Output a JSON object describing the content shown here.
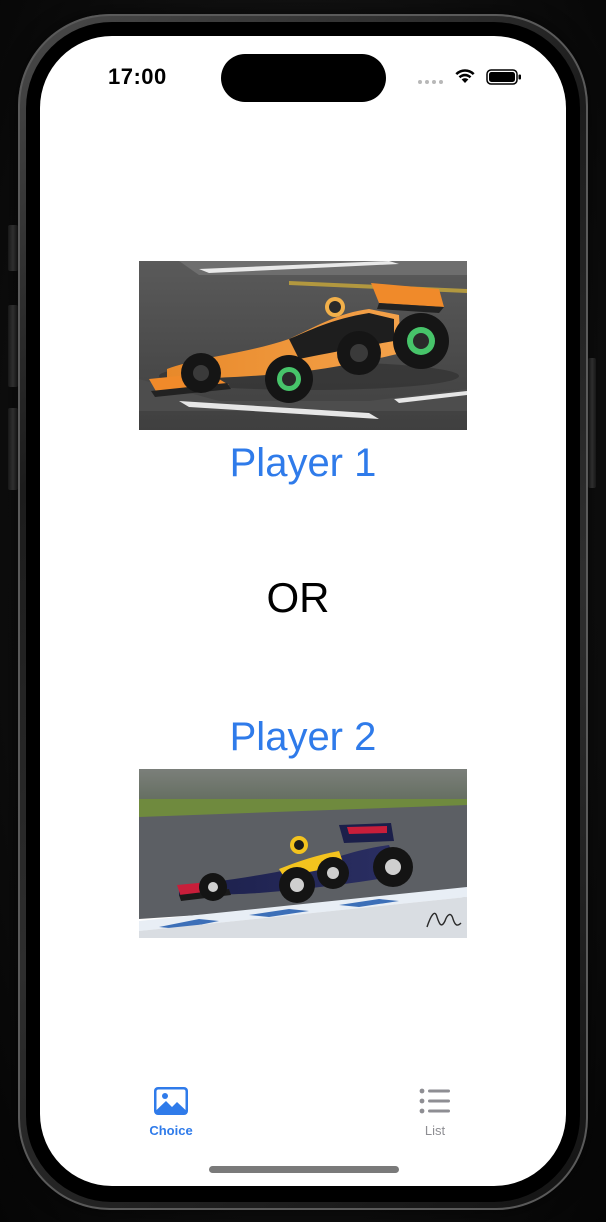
{
  "status_bar": {
    "time": "17:00",
    "icons": [
      "cellular-signal-icon",
      "wifi-icon",
      "battery-icon"
    ]
  },
  "main": {
    "player1": {
      "label": "Player 1",
      "image": "orange-f1-car-photo"
    },
    "separator": "OR",
    "player2": {
      "label": "Player 2",
      "image": "dark-blue-f1-car-photo"
    }
  },
  "tab_bar": {
    "tabs": [
      {
        "label": "Choice",
        "icon": "photo-icon",
        "selected": true
      },
      {
        "label": "List",
        "icon": "list-icon",
        "selected": false
      }
    ]
  },
  "colors": {
    "accent": "#2f7bea",
    "inactive_tab": "#8e8e93",
    "background": "#ffffff"
  }
}
